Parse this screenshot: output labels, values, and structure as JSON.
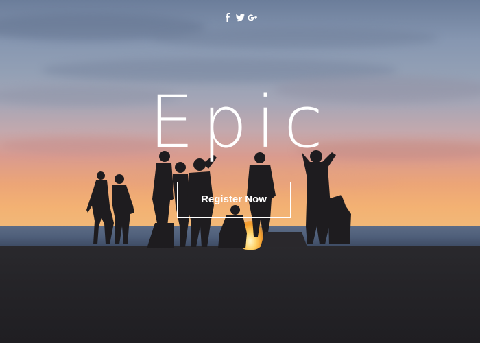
{
  "social": {
    "icons": [
      "facebook-icon",
      "twitter-icon",
      "google-plus-icon"
    ]
  },
  "hero": {
    "title": "Epic",
    "register_label": "Register Now"
  },
  "colors": {
    "text": "#ffffff",
    "sky_top": "#6b7d9a",
    "horizon": "#f1b978",
    "ground": "#1f1e22"
  }
}
